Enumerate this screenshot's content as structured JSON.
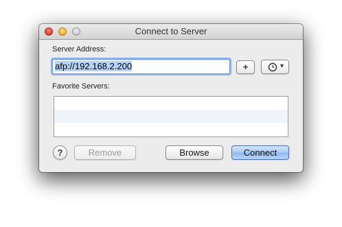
{
  "window": {
    "title": "Connect to Server"
  },
  "server_address": {
    "label": "Server Address:",
    "value": "afp://192.168.2.200"
  },
  "buttons": {
    "add_favorite": "+",
    "recent_servers_icon": "clock-icon",
    "recent_servers_arrow": "▾",
    "help": "?",
    "remove": "Remove",
    "browse": "Browse",
    "connect": "Connect"
  },
  "favorites": {
    "label": "Favorite Servers:",
    "items": []
  }
}
